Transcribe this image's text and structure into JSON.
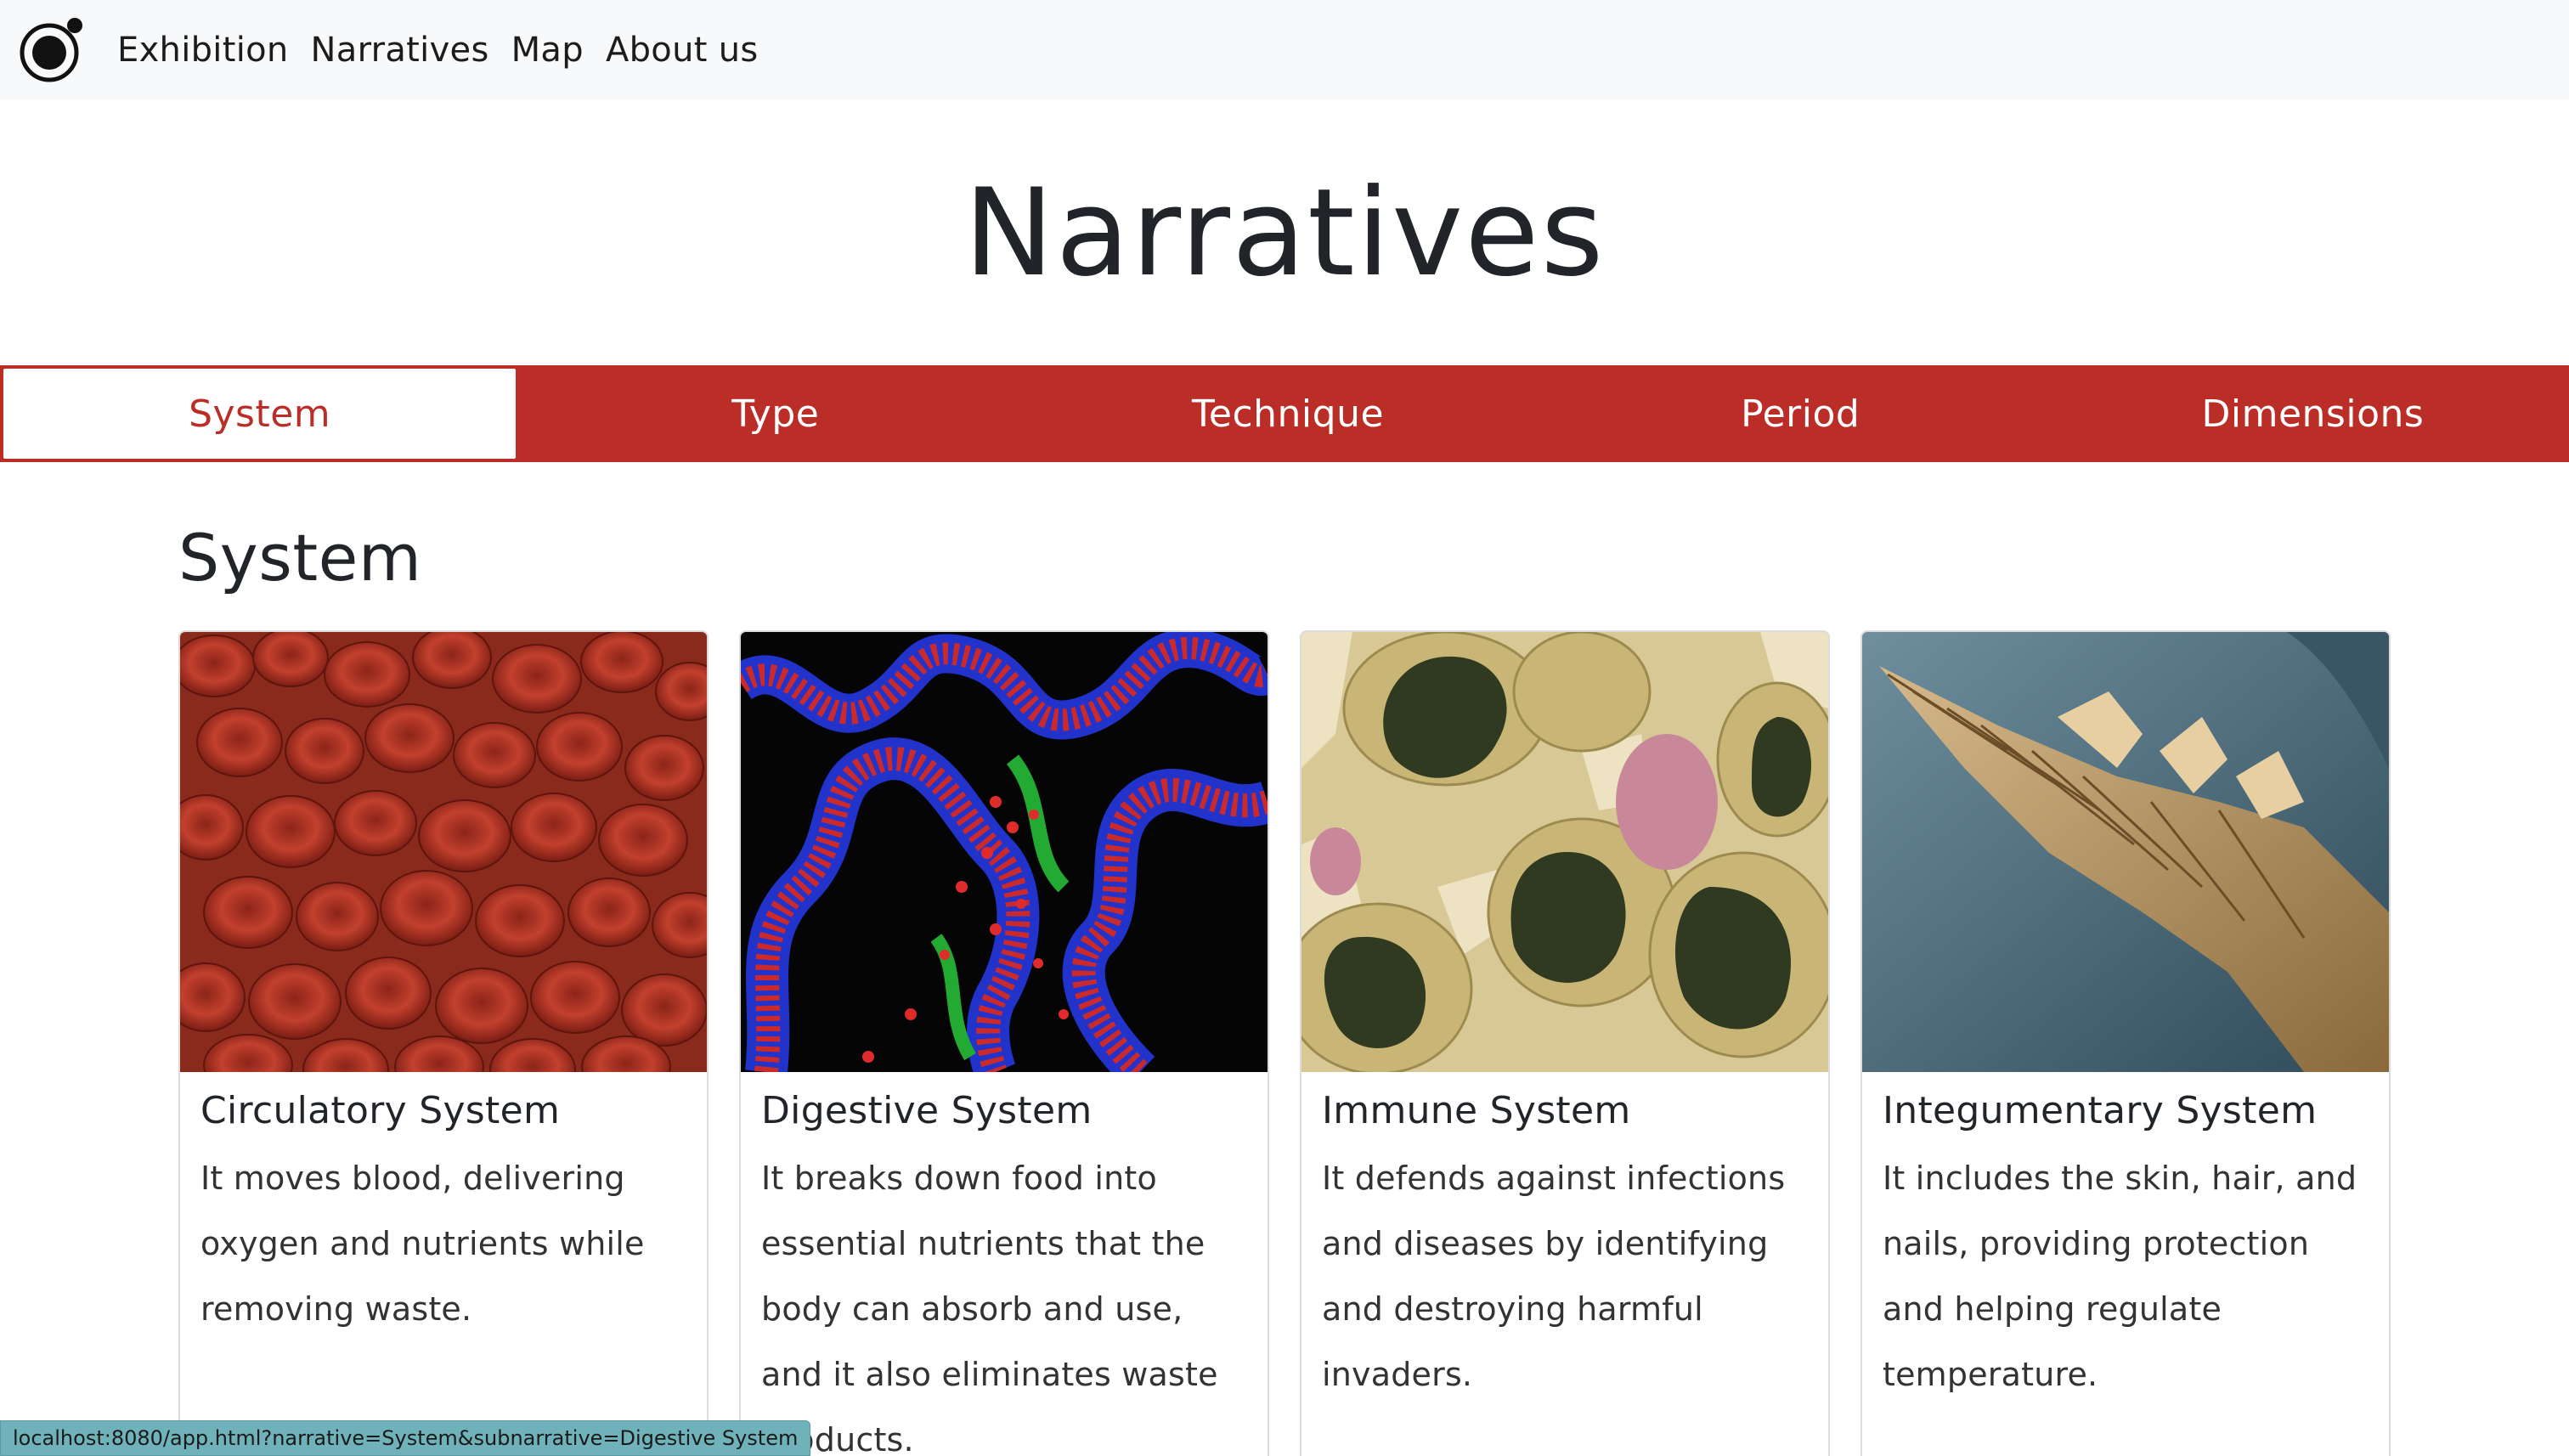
{
  "nav": {
    "logo_icon": "circle-logo-icon",
    "links": [
      "Exhibition",
      "Narratives",
      "Map",
      "About us"
    ]
  },
  "page": {
    "title": "Narratives"
  },
  "tabs": [
    {
      "label": "System",
      "active": true
    },
    {
      "label": "Type",
      "active": false
    },
    {
      "label": "Technique",
      "active": false
    },
    {
      "label": "Period",
      "active": false
    },
    {
      "label": "Dimensions",
      "active": false
    }
  ],
  "section": {
    "title": "System"
  },
  "cards": [
    {
      "title": "Circulatory System",
      "text": "It moves blood, delivering oxygen and nutrients while removing waste.",
      "image": "red-blood-cells-image"
    },
    {
      "title": "Digestive System",
      "text": "It breaks down food into essential nutrients that the body can absorb and use, and it also eliminates waste products.",
      "image": "intestinal-tissue-image"
    },
    {
      "title": "Immune System",
      "text": "It defends against infections and diseases by identifying and destroying harmful invaders.",
      "image": "immune-cells-image"
    },
    {
      "title": "Integumentary System",
      "text": "It includes the skin, hair, and nails, providing protection and helping regulate temperature.",
      "image": "hair-strand-image"
    }
  ],
  "status": {
    "url": "localhost:8080/app.html?narrative=System&subnarrative=Digestive System"
  },
  "colors": {
    "accent": "#bb2d27",
    "navbar_bg": "#f8f9fa"
  }
}
